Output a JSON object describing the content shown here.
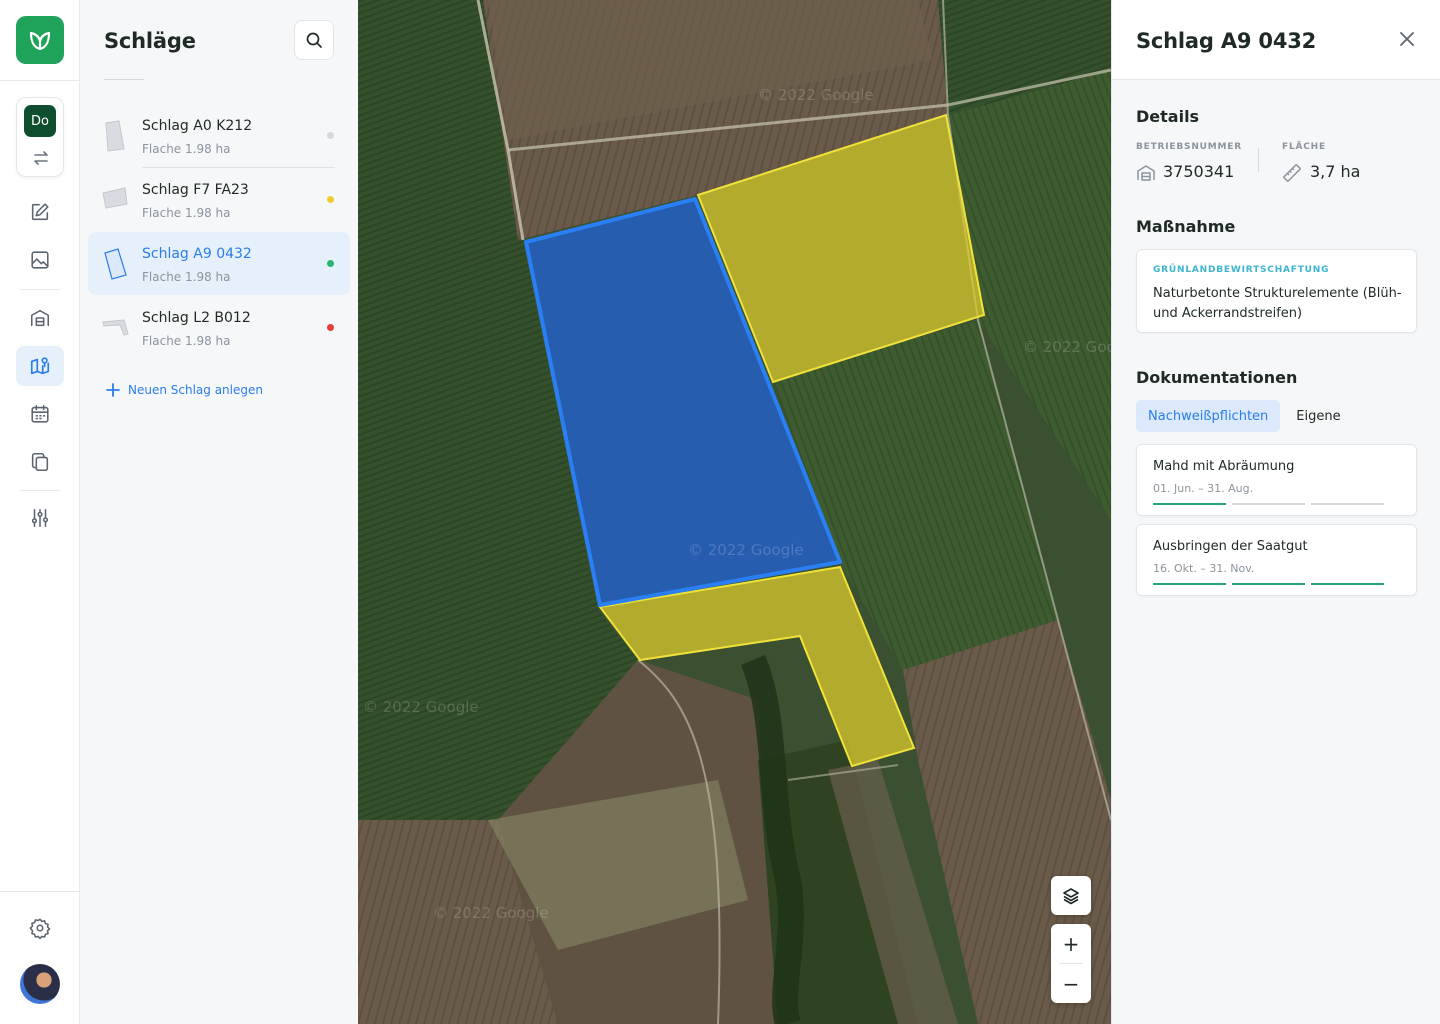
{
  "app": {
    "logo_icon": "leaf-logo-icon",
    "brand_color": "#1fa25a"
  },
  "rail": {
    "switcher_badge": "Do",
    "nav_items": [
      {
        "name": "edit",
        "icon": "pencil-square-icon"
      },
      {
        "name": "images",
        "icon": "image-icon"
      },
      {
        "name": "farm",
        "icon": "barn-icon"
      },
      {
        "name": "map",
        "icon": "map-pin-icon",
        "active": true
      },
      {
        "name": "calendar",
        "icon": "calendar-icon"
      },
      {
        "name": "documents",
        "icon": "copy-icon"
      },
      {
        "name": "filters",
        "icon": "sliders-icon"
      }
    ],
    "settings_icon": "gear-icon",
    "user_icon": "user-avatar"
  },
  "list": {
    "title": "Schläge",
    "fields": [
      {
        "name": "Schlag A0 K212",
        "sub": "Flache 1.98 ha",
        "status_color": "#d5d8dc"
      },
      {
        "name": "Schlag F7 FA23",
        "sub": "Flache 1.98 ha",
        "status_color": "#f2cb2e"
      },
      {
        "name": "Schlag A9 0432",
        "sub": "Flache 1.98 ha",
        "status_color": "#25b570",
        "active": true
      },
      {
        "name": "Schlag L2 B012",
        "sub": "Flache 1.98 ha",
        "status_color": "#e53c3c"
      }
    ],
    "add_label": "Neuen Schlag anlegen"
  },
  "map": {
    "watermark": "© 2022 Google",
    "selected_color": "#1f6fe8",
    "neighbour_color": "#e6d22e",
    "controls": {
      "layers_icon": "layers-icon",
      "zoom_in": "+",
      "zoom_out": "−"
    }
  },
  "detail": {
    "title": "Schlag A9 0432",
    "details_heading": "Details",
    "betriebsnummer_label": "BETRIEBSNUMMER",
    "betriebsnummer_value": "3750341",
    "flaeche_label": "FLÄCHE",
    "flaeche_value": "3,7 ha",
    "measure_heading": "Maßnahme",
    "measure_category": "GRÜNLANDBEWIRTSCHAFTUNG",
    "measure_text": "Naturbetonte Strukturelemente (Blüh- und Ackerrandstreifen)",
    "docs_heading": "Dokumentationen",
    "tabs": [
      "Nachweißpflichten",
      "Eigene"
    ],
    "docs": [
      {
        "title": "Mahd mit Abräumung",
        "date": "01. Jun. – 31. Aug.",
        "progress": [
          1,
          0,
          0
        ]
      },
      {
        "title": "Ausbringen der Saatgut",
        "date": "16. Okt. – 31. Nov.",
        "progress": [
          1,
          1,
          1
        ]
      }
    ]
  }
}
